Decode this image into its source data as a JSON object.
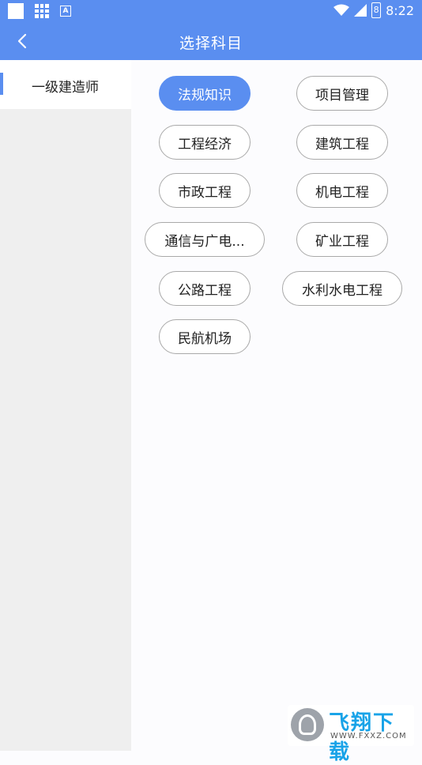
{
  "status_bar": {
    "time": "8:22",
    "battery_text": "8"
  },
  "header": {
    "title": "选择科目"
  },
  "sidebar": {
    "items": [
      {
        "label": "一级建造师",
        "selected": true
      }
    ]
  },
  "subjects": [
    {
      "label": "法规知识",
      "selected": true
    },
    {
      "label": "项目管理",
      "selected": false
    },
    {
      "label": "工程经济",
      "selected": false
    },
    {
      "label": "建筑工程",
      "selected": false
    },
    {
      "label": "市政工程",
      "selected": false
    },
    {
      "label": "机电工程",
      "selected": false
    },
    {
      "label": "通信与广电...",
      "selected": false
    },
    {
      "label": "矿业工程",
      "selected": false
    },
    {
      "label": "公路工程",
      "selected": false
    },
    {
      "label": "水利水电工程",
      "selected": false
    },
    {
      "label": "民航机场",
      "selected": false
    }
  ],
  "watermark": {
    "brand": "飞翔下载",
    "url": "WWW.FXXZ.COM"
  },
  "colors": {
    "accent": "#5a8ef0",
    "chip_border": "#a9a9a9",
    "sidebar_bg": "#efefef"
  }
}
